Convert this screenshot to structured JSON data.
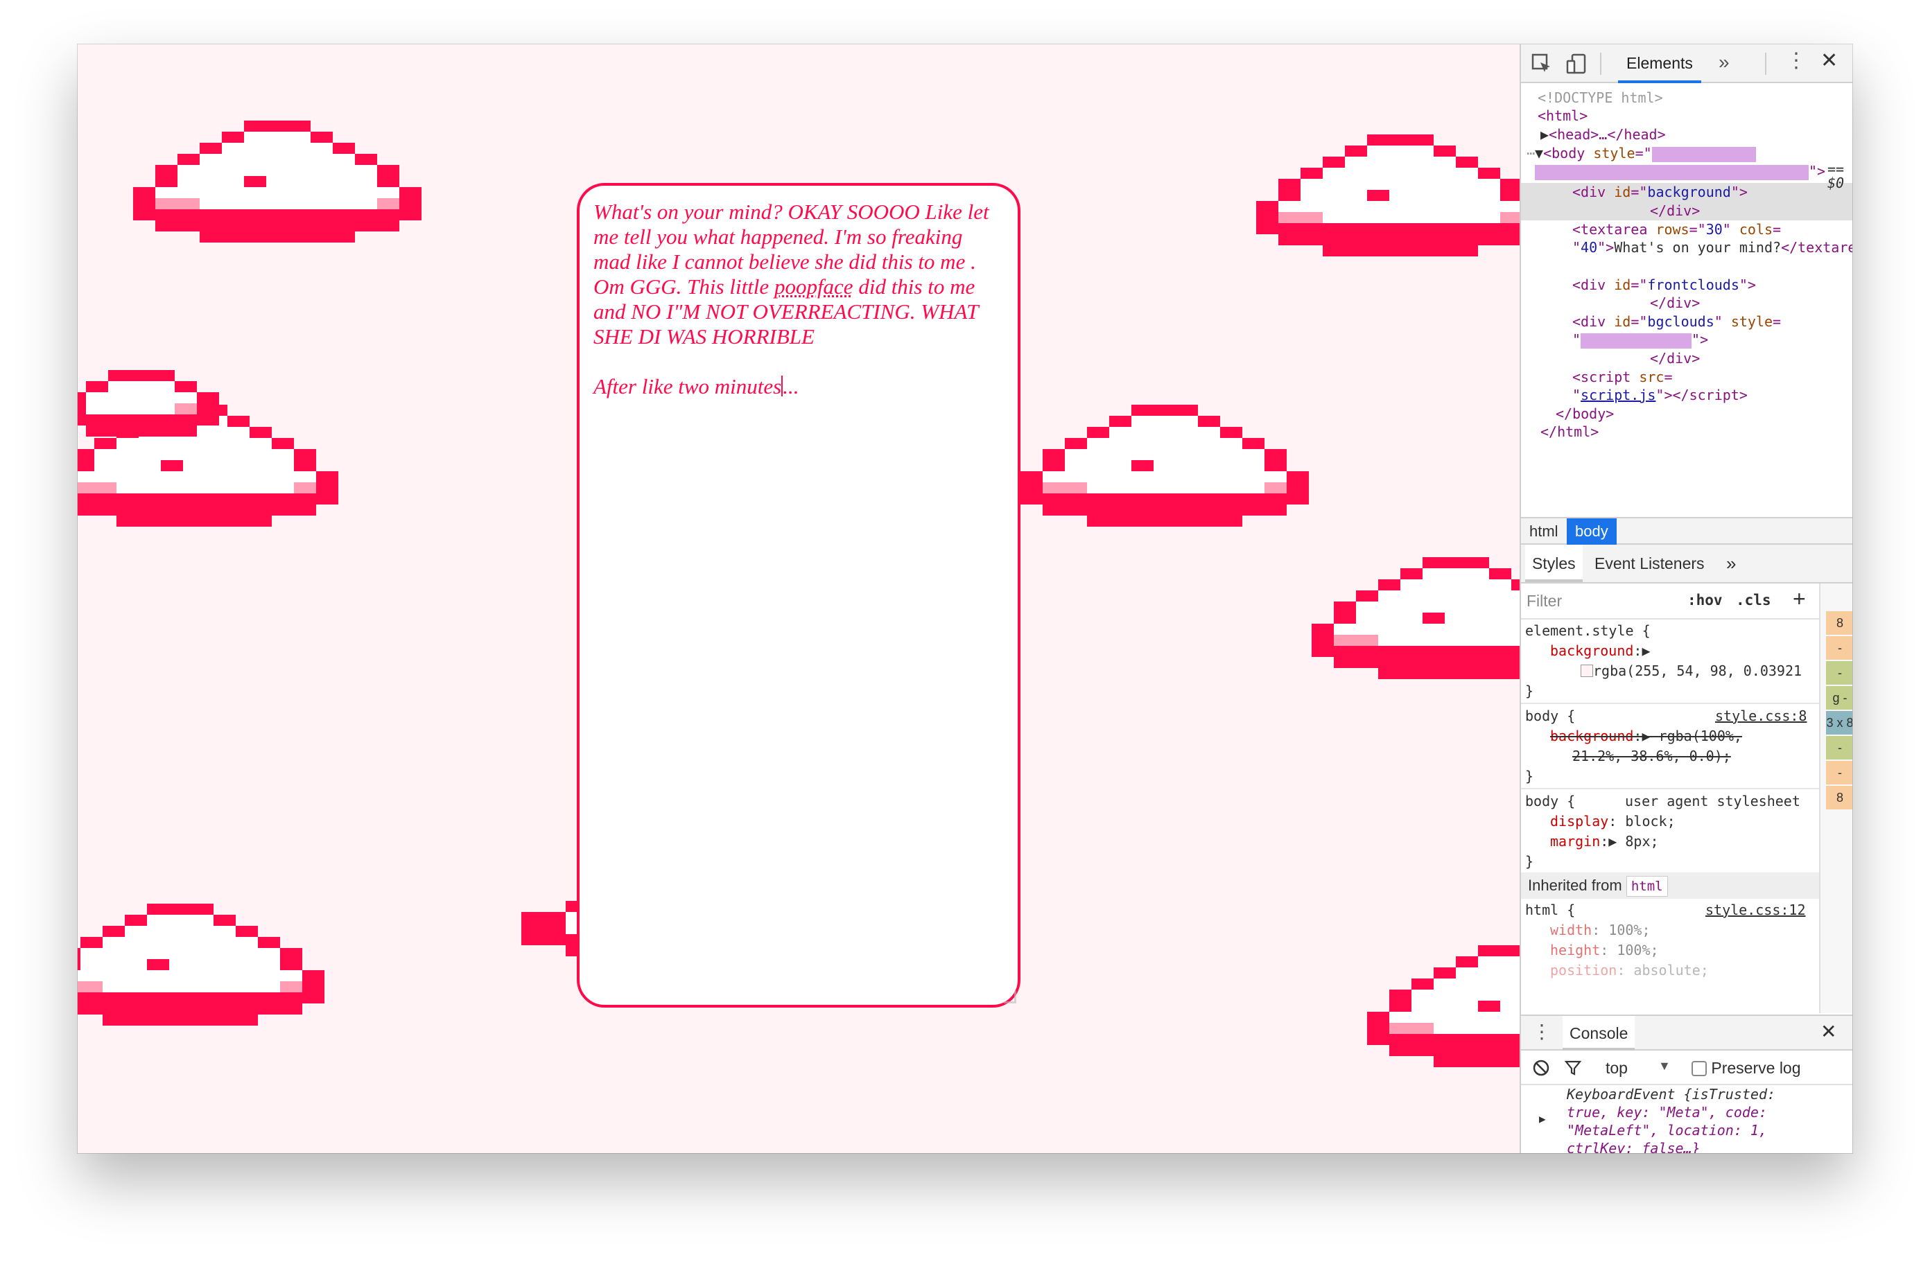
{
  "textarea": {
    "line1": "What's on your mind? OKAY SOOOO Like let me tell you what happened. I'm so freaking mad like I cannot believe she did this to me . Om GGG. This little ",
    "spell_word": "poopface",
    "line1b": " did this to me and NO I\"M NOT OVERREACTING. WHAT SHE DI WAS HORRIBLE",
    "line2": "After like two minutes",
    "line2b": "..."
  },
  "devtools": {
    "tab_elements": "Elements",
    "more_tabs": "»",
    "kebab": "⋮",
    "close": "✕",
    "dom": {
      "doctype": "<!DOCTYPE html>",
      "html_open": "<html>",
      "head": "<head>…</head>",
      "body_open_tag": "<body ",
      "body_attr": "style",
      "eq_dollar": "== $0",
      "div_bg": "background",
      "textarea_rows": "30",
      "textarea_cols": "40",
      "textarea_text": "What's on your mind?",
      "div_front": "frontclouds",
      "div_bgclouds": "bgclouds",
      "script_src": "script.js",
      "body_close": "</body>",
      "html_close": "</html>"
    },
    "breadcrumbs": [
      "html",
      "body"
    ],
    "styles_tabs": [
      "Styles",
      "Event Listeners",
      "»"
    ],
    "filter_placeholder": "Filter",
    "hov": ":hov",
    "cls": ".cls",
    "plus": "+",
    "styles": {
      "element_style": "element.style {",
      "bg_prop": "background",
      "bg_value": "rgba(255, 54, 98, 0.03921",
      "close_brace": "}",
      "body_sel": "body {",
      "body_src": "style.css:8",
      "body_bg_value_1": "rgba(100%,",
      "body_bg_value_2": "21.2%, 38.6%, 0.0);",
      "ua_label": "user agent stylesheet",
      "display_prop": "display",
      "display_val": "block;",
      "margin_prop": "margin",
      "margin_val": "8px;",
      "inherited_label": "Inherited from",
      "inherited_tag": "html",
      "html_sel": "html {",
      "html_src": "style.css:12",
      "width_prop": "width",
      "width_val": "100%;",
      "height_prop": "height",
      "height_val": "100%;",
      "position_prop": "position",
      "position_val": "absolute;"
    },
    "side_swatches": [
      "8",
      "-",
      "-",
      "g -",
      "3 x 8",
      "-",
      "-",
      "8"
    ],
    "console": {
      "title": "Console",
      "context": "top",
      "preserve_log": "Preserve log",
      "entry_1": "KeyboardEvent {isTrusted:",
      "entry_2": "true, key: \"Meta\", code:",
      "entry_3": "\"MetaLeft\", location: 1,",
      "entry_4": "ctrlKey: false…}",
      "prompt": ">"
    }
  },
  "colors": {
    "cloud_red": "#ff0a4a",
    "cloud_pink": "#ff9db5",
    "page_bg": "#fff3f5",
    "accent_blue": "#1a73e8"
  }
}
